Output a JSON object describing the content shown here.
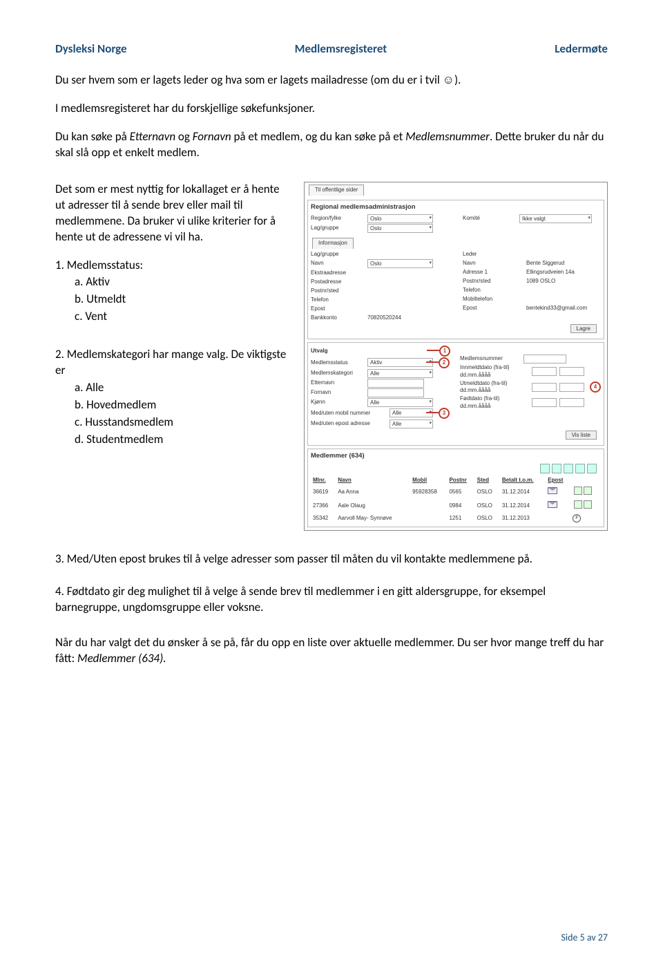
{
  "header": {
    "left": "Dysleksi Norge",
    "center": "Medlemsregisteret",
    "right": "Ledermøte"
  },
  "p1a": "Du ser hvem som er lagets leder og hva som er lagets mailadresse (om du er i tvil ☺).",
  "p1b": "I medlemsregisteret har du forskjellige søkefunksjoner.",
  "p1c_1": "Du kan søke på ",
  "p1c_i1": "Etternavn",
  "p1c_2": " og ",
  "p1c_i2": "Fornavn",
  "p1c_3": " på et medlem, og du kan søke på et ",
  "p1c_i3": "Medlemsnummer",
  "p1c_4": ". Dette bruker du når du skal slå opp et enkelt medlem.",
  "leftcol": {
    "p2": "Det som er mest nyttig for lokallaget er å hente ut adresser til å sende brev eller mail til medlemmene. Da bruker vi ulike kriterier for å hente ut de adressene vi vil ha.",
    "l1": "1.  Medlemsstatus:",
    "l1a": "a.  Aktiv",
    "l1b": "b.  Utmeldt",
    "l1c": "c.  Vent",
    "l2": "2.  Medlemskategori har mange valg. De viktigste er",
    "l2a": "a.  Alle",
    "l2b": "b.  Hovedmedlem",
    "l2c": "c.  Husstandsmedlem",
    "l2d": "d.  Studentmedlem"
  },
  "l3": "3.  Med/Uten epost brukes til å velge adresser som passer til måten du vil kontakte medlemmene på.",
  "l4": "4.  Fødtdato gir deg mulighet til å velge å sende brev til medlemmer i en gitt aldersgruppe, for eksempel barnegruppe, ungdomsgruppe eller voksne.",
  "p_last_1": "Når du har valgt det du ønsker å se på, får du opp en liste over aktuelle medlemmer. Du ser hvor mange treff du har fått: ",
  "p_last_i": "Medlemmer (634).",
  "footer": "Side 5 av 27",
  "shot": {
    "tab": "Til offentlige sider",
    "sec1": "Regional medlemsadministrasjon",
    "region_lbl": "Region/fylke",
    "region_val": "Oslo",
    "komite_lbl": "Komité",
    "komite_val": "Ikke valgt",
    "lag_lbl": "Lag/gruppe",
    "lag_val": "Oslo",
    "info_title": "Informasjon",
    "info_left": {
      "lag": "Lag/gruppe",
      "navn": "Navn",
      "navn_val": "Oslo",
      "ekstra": "Ekstraadresse",
      "post": "Postadresse",
      "postnr": "Postnr/sted",
      "tlf": "Telefon",
      "epost": "Epost",
      "bank": "Bankkonto",
      "bank_val": "70820520244"
    },
    "info_right": {
      "leder": "Leder",
      "navn": "Navn",
      "navn_val": "Bente Siggerud",
      "adr": "Adresse 1",
      "adr_val": "Ellingsrudveien 14a",
      "postnr": "Postnr/sted",
      "postnr_val": "1089 OSLO",
      "tlf": "Telefon",
      "mob": "Mobiltelefon",
      "epost": "Epost",
      "epost_val": "bentekind33@gmail.com"
    },
    "lagre": "Lagre",
    "utvalg": {
      "title": "Utvalg",
      "status_lbl": "Medlemsstatus",
      "status_val": "Aktiv",
      "kat_lbl": "Medlemskategori",
      "kat_val": "Alle",
      "ettern": "Etternavn",
      "fornavn": "Fornavn",
      "kjonn_lbl": "Kjønn",
      "kjonn_val": "Alle",
      "mobil_lbl": "Med/uten mobil nummer",
      "mobil_val": "Alle",
      "epost_lbl": "Med/uten epost adresse",
      "epost_val": "Alle",
      "mnr": "Medlemsnummer",
      "inn": "Innmeldtdato (fra-til) dd.mm.åååå",
      "ut": "Utmeldtdato (fra-til) dd.mm.åååå",
      "fodt": "Fødtdato (fra-til) dd.mm.åååå",
      "visliste": "Vis liste"
    },
    "members_title": "Medlemmer (634)",
    "tbl": {
      "h": [
        "Mlnr.",
        "Navn",
        "Mobil",
        "Postnr",
        "Sted",
        "Betalt t.o.m.",
        "Epost"
      ],
      "rows": [
        [
          "36619",
          "Aa Anna",
          "95928358",
          "0565",
          "OSLO",
          "31.12.2014",
          "✉"
        ],
        [
          "27366",
          "Aale Olaug",
          "",
          "0984",
          "OSLO",
          "31.12.2014",
          "✉"
        ],
        [
          "35342",
          "Aarvoll May- Synnøve",
          "",
          "1251",
          "OSLO",
          "31.12.2013",
          "F"
        ]
      ]
    },
    "callouts": {
      "c1": "1",
      "c2": "2",
      "c3": "3",
      "c4": "4"
    }
  }
}
